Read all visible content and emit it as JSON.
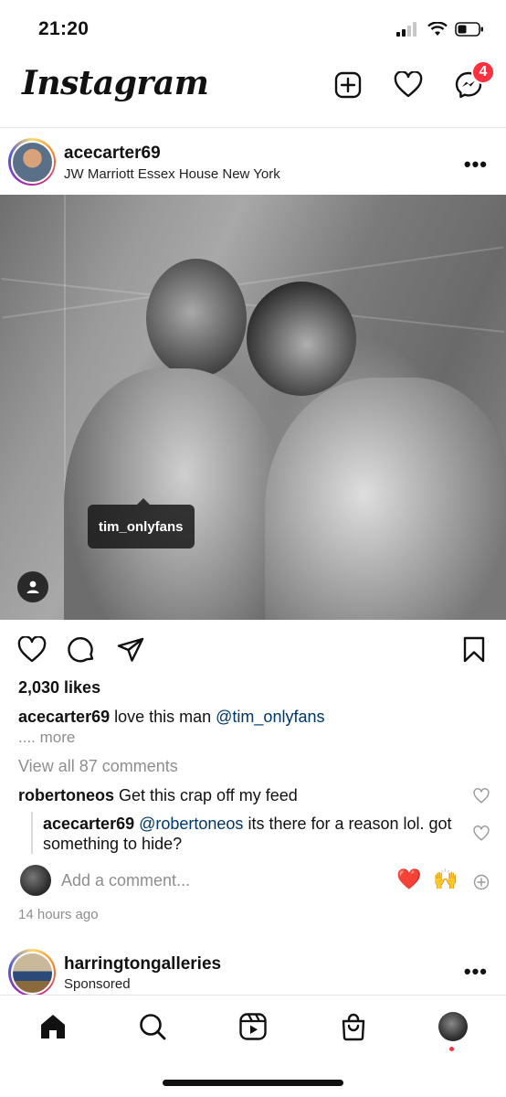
{
  "status_bar": {
    "time": "21:20"
  },
  "header": {
    "logo_text": "Instagram",
    "messages_badge": "4",
    "badge_color": "#ff3040"
  },
  "post": {
    "username": "acecarter69",
    "location": "JW Marriott Essex House New York",
    "tag_label": "tim_onlyfans",
    "likes": "2,030 likes",
    "caption_user": "acecarter69",
    "caption_text": " love this man ",
    "caption_mention": "@tim_onlyfans",
    "caption_more": ".... more",
    "view_all_comments": "View all 87 comments",
    "comments": [
      {
        "user": "robertoneos",
        "text": " Get this crap off my feed"
      }
    ],
    "reply": {
      "user": "acecarter69",
      "mention": " @robertoneos",
      "text": " its there for a reason lol. got something to hide?"
    },
    "add_comment_placeholder": "Add a comment...",
    "quick_emojis": [
      "❤️",
      "🙌"
    ],
    "time_ago": "14 hours ago"
  },
  "next_post": {
    "username": "harringtongalleries",
    "subtitle": "Sponsored"
  },
  "bottom_nav": {
    "items": [
      "home-icon",
      "search-icon",
      "reels-icon",
      "shop-icon",
      "profile-avatar"
    ]
  },
  "colors": {
    "link": "#00376b",
    "secondary_text": "#8e8e8e"
  }
}
